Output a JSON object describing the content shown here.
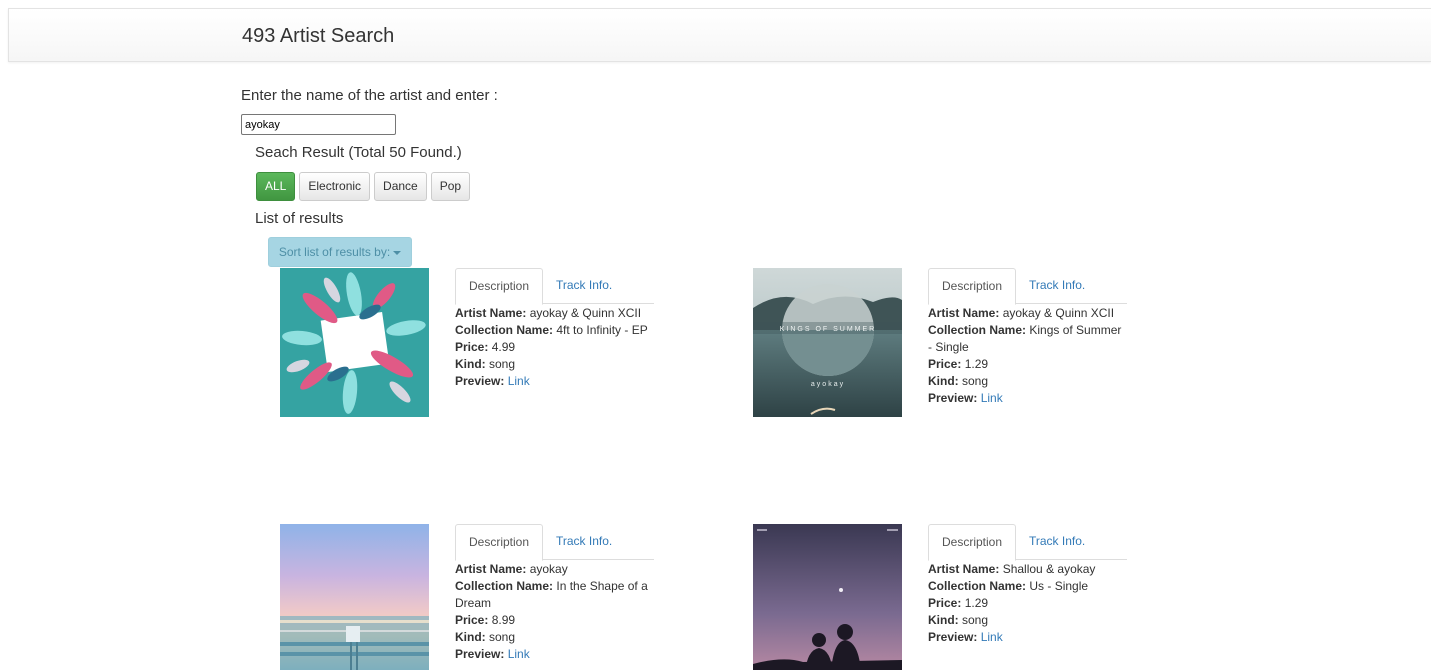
{
  "header": {
    "title": "493 Artist Search"
  },
  "search": {
    "prompt": "Enter the name of the artist and enter :",
    "value": "ayokay"
  },
  "summary": "Seach Result (Total 50 Found.)",
  "filters": [
    "ALL",
    "Electronic",
    "Dance",
    "Pop"
  ],
  "list_heading": "List of results",
  "sort_button": "Sort list of results by:",
  "labels": {
    "artist": "Artist Name:",
    "collection": "Collection Name:",
    "price": "Price:",
    "kind": "Kind:",
    "preview": "Preview:"
  },
  "tabs": {
    "description": "Description",
    "track_info": "Track Info."
  },
  "results": [
    {
      "artist": "ayokay & Quinn XCII",
      "collection": "4ft to Infinity - EP",
      "price": "4.99",
      "kind": "song",
      "preview": "Link"
    },
    {
      "artist": "ayokay & Quinn XCII",
      "collection": "Kings of Summer - Single",
      "price": "1.29",
      "kind": "song",
      "preview": "Link",
      "cover_text": "KINGS OF SUMMER",
      "cover_artist": "ayokay"
    },
    {
      "artist": "ayokay",
      "collection": "In the Shape of a Dream",
      "price": "8.99",
      "kind": "song",
      "preview": "Link"
    },
    {
      "artist": "Shallou & ayokay",
      "collection": "Us - Single",
      "price": "1.29",
      "kind": "song",
      "preview": "Link"
    }
  ],
  "colors": {
    "active_filter": "#5cb85c",
    "sort_button": "#a6d5e3",
    "link": "#337ab7"
  }
}
